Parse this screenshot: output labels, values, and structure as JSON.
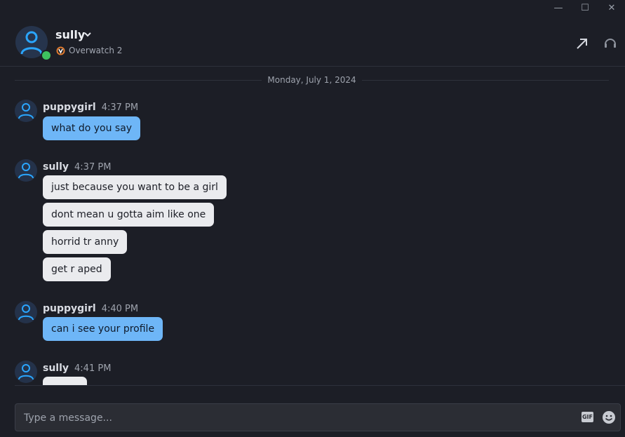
{
  "window_controls": {
    "minimize": "—",
    "maximize": "☐",
    "close": "✕"
  },
  "header": {
    "username": "sully",
    "status": "online",
    "game": "Overwatch 2"
  },
  "date_separator": "Monday, July 1, 2024",
  "messages": [
    {
      "author": "puppygirl",
      "time": "4:37 PM",
      "bubbles": [
        "what do you say"
      ],
      "style": "blue"
    },
    {
      "author": "sully",
      "time": "4:37 PM",
      "bubbles": [
        "just because you want to be a girl",
        "dont mean u gotta aim like one",
        "horrid tr anny",
        "get r aped"
      ],
      "style": "grey"
    },
    {
      "author": "puppygirl",
      "time": "4:40 PM",
      "bubbles": [
        "can i see your profile"
      ],
      "style": "blue"
    },
    {
      "author": "sully",
      "time": "4:41 PM",
      "bubbles": [
        ""
      ],
      "style": "grey"
    }
  ],
  "composer": {
    "placeholder": "Type a message...",
    "gif_label": "GIF"
  },
  "colors": {
    "outgoing_bubble": "#6eb6f7",
    "incoming_bubble": "#eaebee",
    "online": "#3ec15f",
    "background": "#1c1e26"
  }
}
